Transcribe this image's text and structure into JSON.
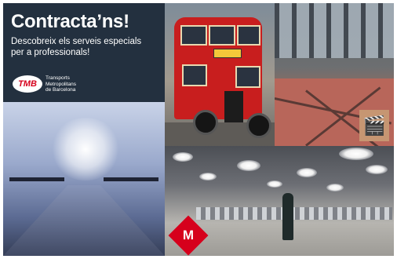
{
  "promo": {
    "title": "Contracta’ns!",
    "subtitle": "Descobreix els serveis especials per a professionals!",
    "logo_text": "TMB",
    "company_name": "Transports\nMetropolitans\nde Barcelona"
  },
  "tiles": {
    "bus_sign": "",
    "clapper_icon": "clapperboard-icon",
    "metro_logo": "M"
  },
  "colors": {
    "brand_red": "#d6001c",
    "promo_bg": "#23303f"
  }
}
